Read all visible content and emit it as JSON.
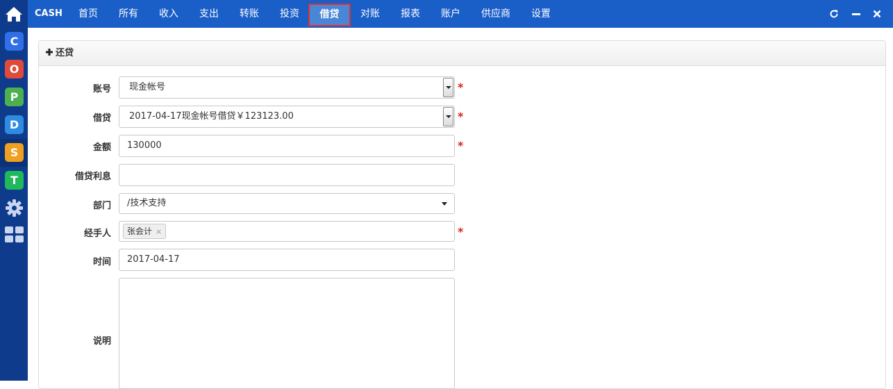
{
  "app": {
    "brand": "CASH"
  },
  "nav": {
    "items": [
      "首页",
      "所有",
      "收入",
      "支出",
      "转账",
      "投资",
      "借贷",
      "对账",
      "报表",
      "账户",
      "供应商",
      "设置"
    ],
    "active": "借贷"
  },
  "window_controls": {
    "refresh_icon": "refresh-icon",
    "minimize_icon": "minimize-icon",
    "close_icon": "close-icon"
  },
  "sidebar": {
    "icons": [
      {
        "name": "home-icon",
        "letter": "",
        "color": "#ffffff"
      },
      {
        "name": "c-app-icon",
        "letter": "C",
        "color": "#2f6fe8"
      },
      {
        "name": "o-app-icon",
        "letter": "O",
        "color": "#e04a3a"
      },
      {
        "name": "p-app-icon",
        "letter": "P",
        "color": "#4caf50"
      },
      {
        "name": "d-app-icon",
        "letter": "D",
        "color": "#2e8be0"
      },
      {
        "name": "s-app-icon",
        "letter": "S",
        "color": "#f0a020"
      },
      {
        "name": "t-app-icon",
        "letter": "T",
        "color": "#1fb85a"
      },
      {
        "name": "gear-icon",
        "letter": "",
        "color": "#c9d6ee"
      },
      {
        "name": "grid-icon",
        "letter": "",
        "color": "#c9d6ee"
      }
    ]
  },
  "panel": {
    "title": "还贷",
    "title_icon": "plus-icon"
  },
  "form": {
    "account": {
      "label": "账号",
      "value": "现金帐号",
      "required": "*"
    },
    "loan": {
      "label": "借贷",
      "value": "2017-04-17现金帐号借贷￥123123.00",
      "required": "*"
    },
    "amount": {
      "label": "金额",
      "value": "130000",
      "required": "*"
    },
    "interest": {
      "label": "借贷利息",
      "value": ""
    },
    "department": {
      "label": "部门",
      "value": "/技术支持"
    },
    "handler": {
      "label": "经手人",
      "tag": "张会计",
      "tag_remove": "×",
      "required": "*"
    },
    "date": {
      "label": "时间",
      "value": "2017-04-17"
    },
    "note": {
      "label": "说明",
      "value": ""
    }
  }
}
